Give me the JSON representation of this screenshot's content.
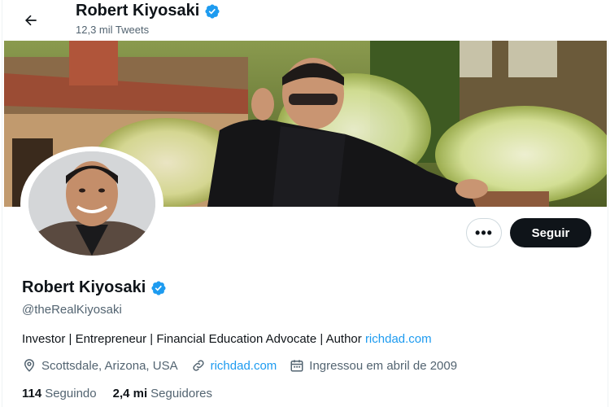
{
  "header": {
    "back_icon": "arrow-left-icon",
    "name": "Robert Kiyosaki",
    "tweet_count": "12,3 mil Tweets"
  },
  "profile": {
    "name": "Robert Kiyosaki",
    "verified_icon": "verified-badge-icon",
    "handle": "@theRealKiyosaki",
    "bio_text": "Investor | Entrepreneur | Financial Education Advocate | Author ",
    "bio_link": "richdad.com",
    "location": "Scottsdale, Arizona, USA",
    "website": "richdad.com",
    "joined": "Ingressou em abril de 2009"
  },
  "actions": {
    "more_label": "•••",
    "follow_label": "Seguir"
  },
  "stats": {
    "following_count": "114",
    "following_label": "Seguindo",
    "followers_count": "2,4 mi",
    "followers_label": "Seguidores"
  },
  "colors": {
    "accent": "#1d9bf0",
    "text": "#0f1419",
    "muted": "#536471"
  }
}
